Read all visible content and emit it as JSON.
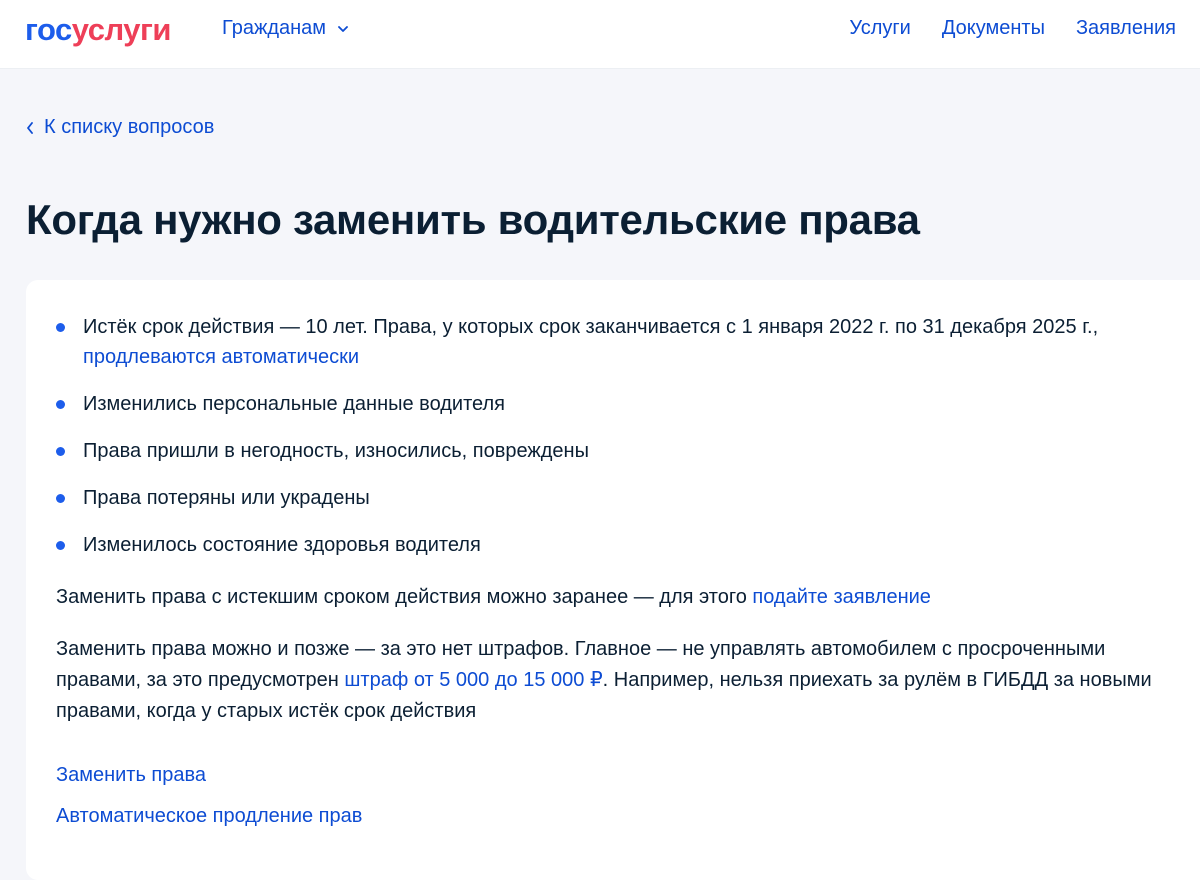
{
  "header": {
    "logo_part1": "гос",
    "logo_part2": "услуги",
    "audience_menu": "Гражданам",
    "nav": [
      "Услуги",
      "Документы",
      "Заявления"
    ]
  },
  "breadcrumb": {
    "back_label": "К списку вопросов"
  },
  "page": {
    "title": "Когда нужно заменить водительские права"
  },
  "bullets": [
    {
      "text": "Истёк срок действия — 10 лет. Права, у которых срок заканчивается с 1 января 2022 г. по 31 декабря 2025 г.,",
      "link": "продлеваются автоматически"
    },
    {
      "text": "Изменились персональные данные водителя"
    },
    {
      "text": "Права пришли в негодность, износились, повреждены"
    },
    {
      "text": "Права потеряны или украдены"
    },
    {
      "text": "Изменилось состояние здоровья водителя"
    }
  ],
  "paragraphs": {
    "p1_text": "Заменить права с истекшим сроком действия можно заранее — для этого ",
    "p1_link": "подайте заявление",
    "p2_text1": "Заменить права можно и позже — за это нет штрафов. Главное — не управлять автомобилем с просроченными правами, за это предусмотрен ",
    "p2_link": "штраф от 5 000 до 15 000 ₽",
    "p2_text2": ". Например, нельзя приехать за рулём в ГИБДД за новыми правами, когда у старых истёк срок действия"
  },
  "links": {
    "replace_license": "Заменить права",
    "auto_renewal": "Автоматическое продление прав"
  },
  "colors": {
    "brand_blue": "#1d5deb",
    "brand_red": "#ee3f58",
    "link_blue": "#0d4cd3",
    "text_dark": "#0b1f33"
  }
}
